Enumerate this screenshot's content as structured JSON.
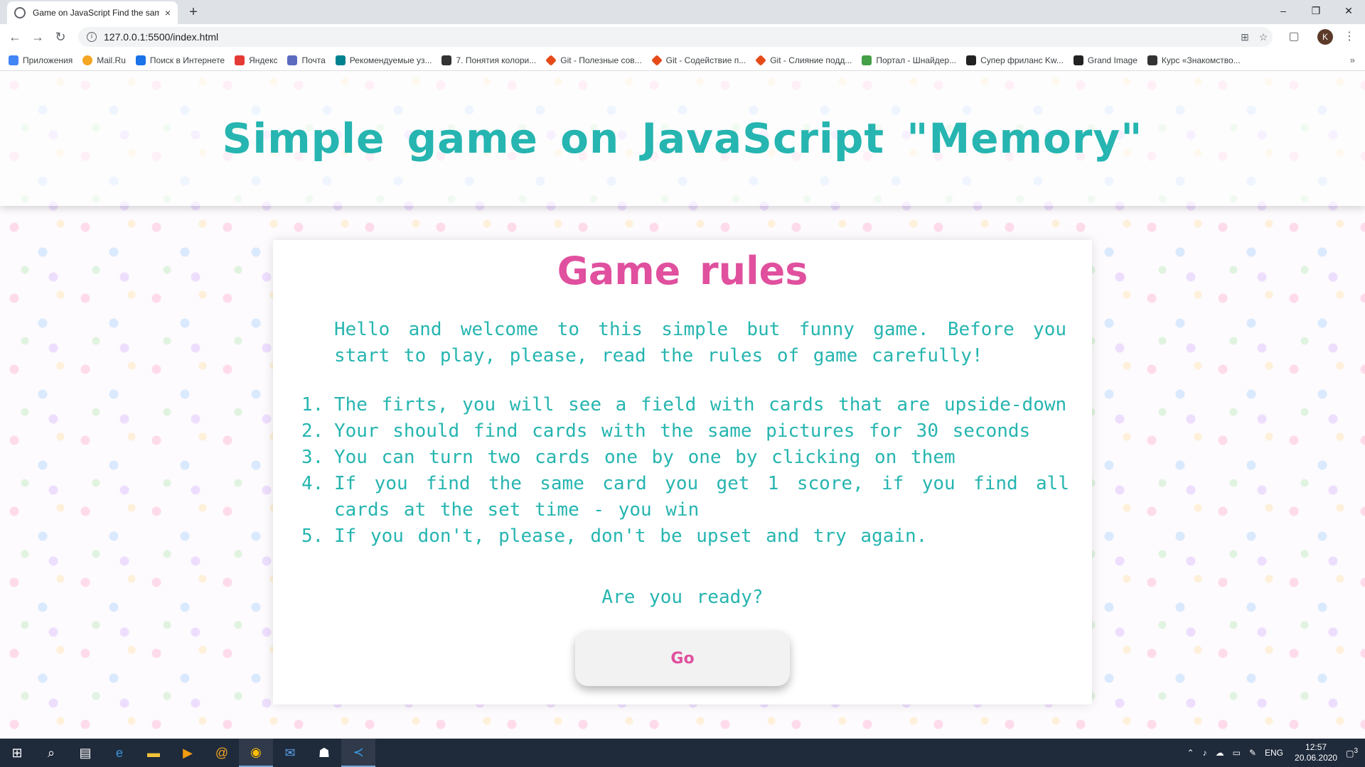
{
  "browser": {
    "tab_title": "Game on JavaScript Find the same",
    "tab_close": "×",
    "new_tab": "+",
    "url": "127.0.0.1:5500/index.html",
    "window_controls": [
      "–",
      "❐",
      "✕"
    ],
    "profile_initial": "K",
    "bookmarks": [
      {
        "label": "Приложения",
        "color": "#4285f4"
      },
      {
        "label": "Mail.Ru",
        "color": "#f5a623"
      },
      {
        "label": "Поиск в Интернете",
        "color": "#1a73e8"
      },
      {
        "label": "Яндекс",
        "color": "#e53935"
      },
      {
        "label": "Почта",
        "color": "#5c6bc0"
      },
      {
        "label": "Рекомендуемые уз...",
        "color": "#00838f"
      },
      {
        "label": "7. Понятия колори...",
        "color": "#333333"
      },
      {
        "label": "Git - Полезные сов...",
        "color": "#e64a19"
      },
      {
        "label": "Git - Содействие п...",
        "color": "#e64a19"
      },
      {
        "label": "Git - Слияние подд...",
        "color": "#e64a19"
      },
      {
        "label": "Портал - Шнайдер...",
        "color": "#43a047"
      },
      {
        "label": "Супер фриланс Kw...",
        "color": "#222222"
      },
      {
        "label": "Grand Image",
        "color": "#222222"
      },
      {
        "label": "Курс «Знакомство...",
        "color": "#333333"
      }
    ],
    "bookmarks_more": "»"
  },
  "page": {
    "title": "Simple game on JavaScript \"Memory\"",
    "rules_title": "Game rules",
    "intro": "Hello and welcome to this simple but funny game. Before you start to play, please, read the rules of game carefully!",
    "rules": [
      {
        "num": "1.",
        "text": "The firts, you will see a field with cards that are upside-down"
      },
      {
        "num": "2.",
        "text": "Your should find cards with the same pictures for 30 seconds"
      },
      {
        "num": "3.",
        "text": "You can turn two cards one by one by clicking on them"
      },
      {
        "num": "4.",
        "text": "If you find the same card you get 1 score, if you find all cards at the set time - you win"
      },
      {
        "num": "5.",
        "text": "If you don't, please, don't be upset and try again."
      }
    ],
    "ready": "Are you ready?",
    "go_label": "Go"
  },
  "taskbar": {
    "language": "ENG",
    "time": "12:57",
    "date": "20.06.2020",
    "notifications": "3"
  },
  "colors": {
    "accent_teal": "#26b5b0",
    "accent_pink": "#e0509e"
  }
}
